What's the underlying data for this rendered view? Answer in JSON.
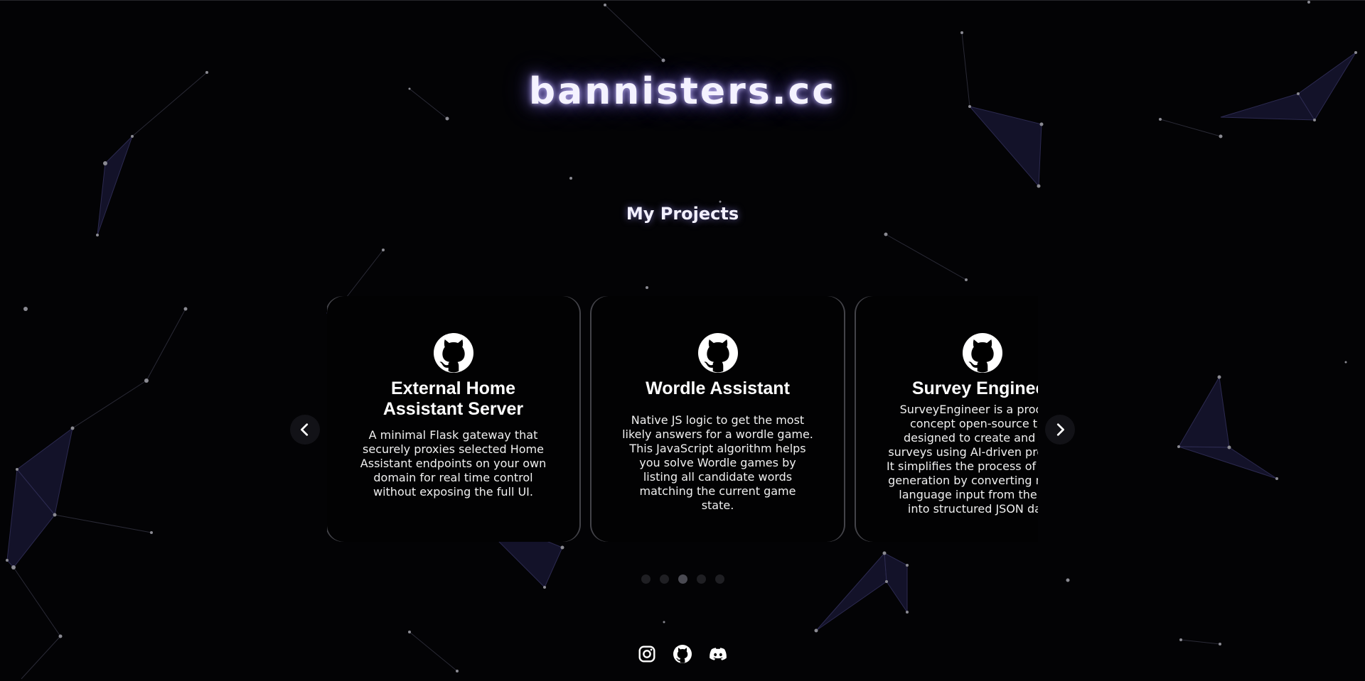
{
  "site": {
    "title": "bannisters.cc"
  },
  "projects": {
    "heading": "My Projects",
    "cards": [
      {
        "title": "External Home Assistant Server",
        "description": "A minimal Flask gateway that securely proxies selected Home Assistant endpoints on your own domain for real time control without exposing the full UI.",
        "icon": "github-icon"
      },
      {
        "title": "Wordle Assistant",
        "description": "Native JS logic to get the most likely answers for a wordle game. This JavaScript algorithm helps you solve Wordle games by listing all candidate words matching the current game state.",
        "icon": "github-icon"
      },
      {
        "title": "Survey Engineer",
        "description": "SurveyEngineer is a proof-of-concept open-source tool designed to create and edit surveys using AI-driven prompts. It simplifies the process of survey generation by converting natural language input from the user into structured JSON data.",
        "icon": "github-icon"
      }
    ],
    "prev_icon": "chevron-left-icon",
    "next_icon": "chevron-right-icon",
    "pagination": {
      "total": 5,
      "active_index": 2
    }
  },
  "socials": [
    {
      "name": "instagram",
      "icon": "instagram-icon"
    },
    {
      "name": "github",
      "icon": "github-icon"
    },
    {
      "name": "discord",
      "icon": "discord-icon"
    }
  ],
  "colors": {
    "background": "#030305",
    "accent": "#a89cff",
    "network_fill": "#1c1a3a",
    "network_line": "#2e2c52",
    "node": "#8a8a92"
  }
}
